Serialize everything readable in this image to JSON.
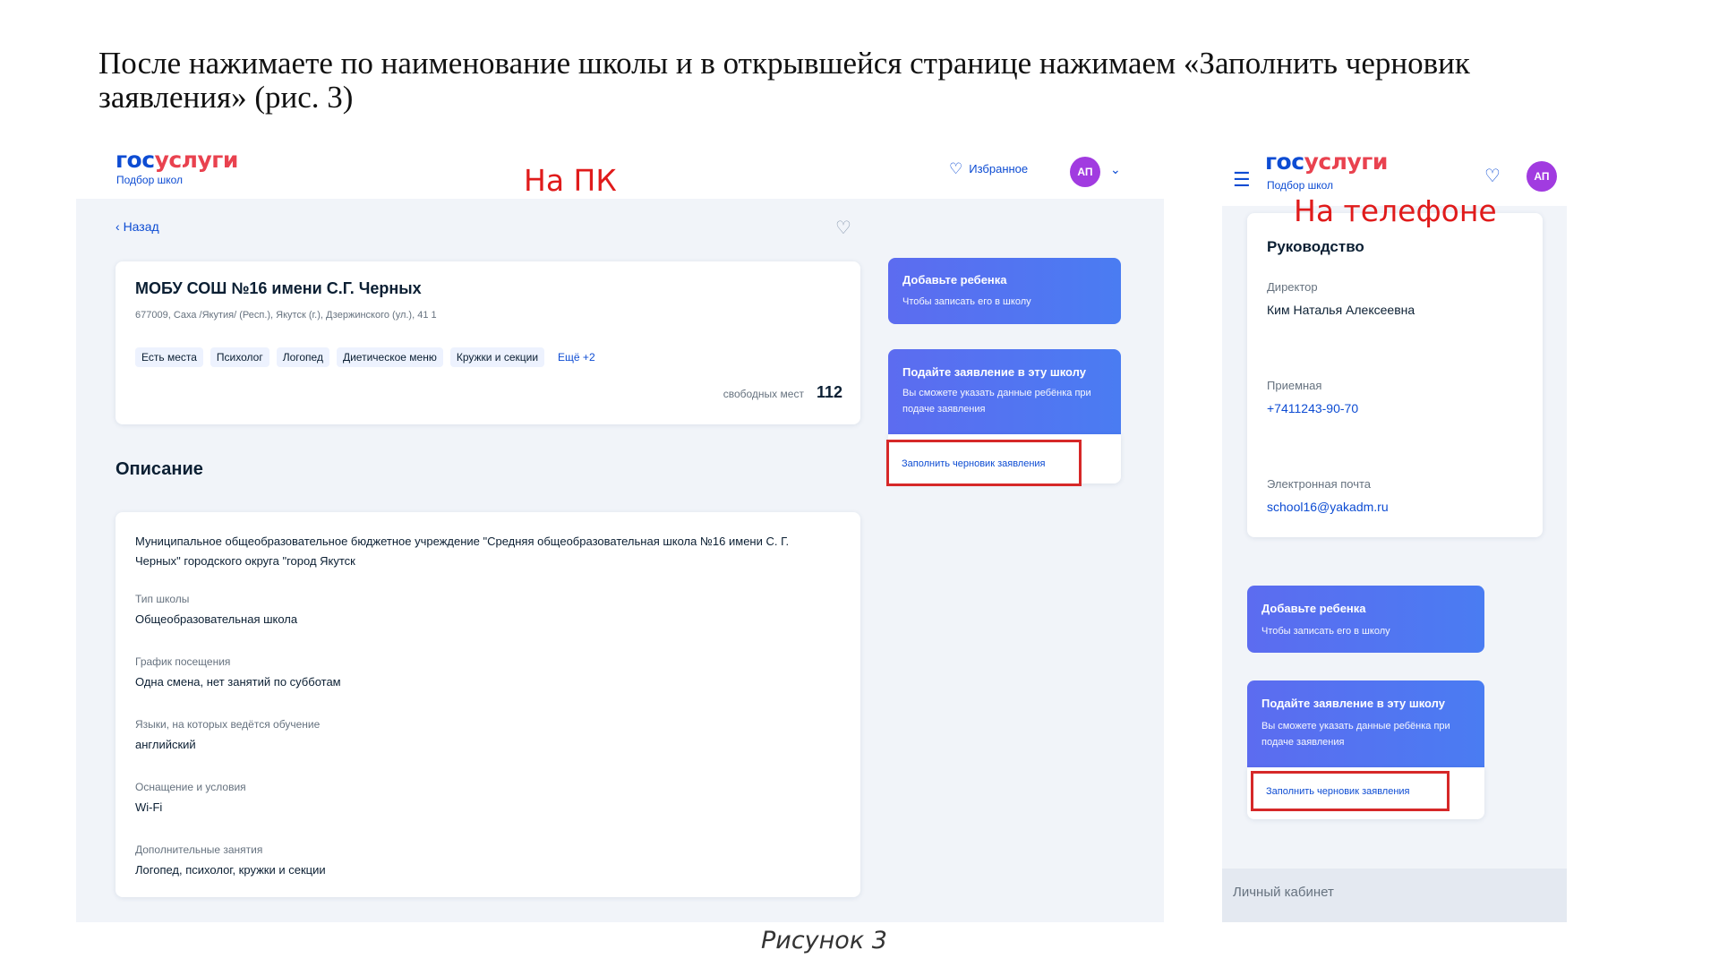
{
  "instruction": {
    "line1": "После нажимаете по наименование школы и в открывшейся странице нажимаем «Заполнить черновик",
    "line2": "заявления» (рис. 3)"
  },
  "brand": {
    "logo_part1": "гос",
    "logo_part2": "услуги",
    "subtitle": "Подбор школ"
  },
  "desktop": {
    "caption": "На ПК",
    "favorites_label": "Избранное",
    "avatar_initials": "АП",
    "back_label": "Назад",
    "school": {
      "name": "МОБУ СОШ №16 имени С.Г. Черных",
      "address": "677009, Саха /Якутия/ (Респ.), Якутск (г.), Дзержинского (ул.), 41 1",
      "tags": [
        "Есть места",
        "Психолог",
        "Логопед",
        "Диетическое меню",
        "Кружки и секции",
        "Ещё +2"
      ],
      "seats_label": "свободных мест",
      "seats_value": "112"
    },
    "description": {
      "title": "Описание",
      "intro": "Муниципальное общеобразовательное бюджетное учреждение \"Средняя общеобразовательная школа №16 имени С. Г. Черных\" городского округа \"город Якутск",
      "items": [
        {
          "label": "Тип школы",
          "value": "Общеобразовательная школа"
        },
        {
          "label": "График посещения",
          "value": "Одна смена, нет занятий по субботам"
        },
        {
          "label": "Языки, на которых ведётся обучение",
          "value": "английский"
        },
        {
          "label": "Оснащение и условия",
          "value": "Wi-Fi"
        },
        {
          "label": "Дополнительные занятия",
          "value": "Логопед, психолог, кружки и секции"
        }
      ]
    },
    "add_child": {
      "title": "Добавьте ребенка",
      "text": "Чтобы записать его в школу"
    },
    "apply": {
      "title": "Подайте заявление в эту школу",
      "text": "Вы сможете указать данные ребёнка при подаче заявления"
    },
    "draft_link": "Заполнить черновик заявления"
  },
  "phone": {
    "caption": "На телефоне",
    "avatar_initials": "АП",
    "management": {
      "title": "Руководство",
      "director_label": "Директор",
      "director_value": "Ким Наталья Алексеевна",
      "reception_label": "Приемная",
      "reception_value": "+7411243-90-70",
      "email_label": "Электронная почта",
      "email_value": "school16@yakadm.ru"
    },
    "add_child": {
      "title": "Добавьте ребенка",
      "text": "Чтобы записать его в школу"
    },
    "apply": {
      "title": "Подайте заявление в эту школу",
      "text": "Вы сможете указать данные ребёнка при подаче заявления"
    },
    "draft_link": "Заполнить черновик заявления",
    "footer_label": "Личный кабинет"
  },
  "figure_caption": "Рисунок 3",
  "colors": {
    "brand_blue": "#0d4cd3",
    "brand_red": "#e9424f",
    "highlight_red": "#d62828",
    "avatar_purple": "#a13be0"
  }
}
